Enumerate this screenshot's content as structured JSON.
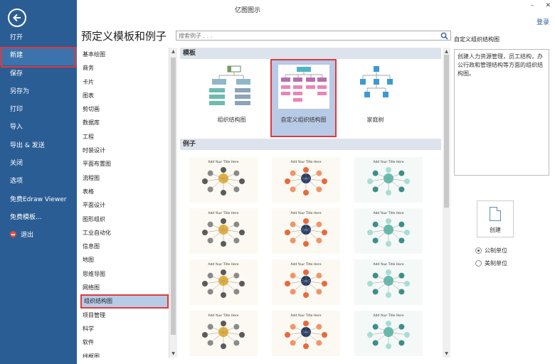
{
  "window": {
    "title": "亿图图示",
    "minimize": "–",
    "close": "✕",
    "login": "登录"
  },
  "rail": {
    "items": [
      {
        "label": "打开"
      },
      {
        "label": "新建",
        "selected": true
      },
      {
        "label": "保存"
      },
      {
        "label": "另存为"
      },
      {
        "label": "打印"
      },
      {
        "label": "导入"
      },
      {
        "label": "导出 & 发送"
      },
      {
        "label": "关闭"
      },
      {
        "label": "选项"
      },
      {
        "label": "免费Edraw Viewer"
      },
      {
        "label": "免费模板..."
      },
      {
        "label": "退出"
      }
    ]
  },
  "main": {
    "title": "预定义模板和例子",
    "search_placeholder": "搜索例子 . . ."
  },
  "categories": [
    "基本绘图",
    "商务",
    "卡片",
    "图表",
    "剪切画",
    "数据库",
    "工程",
    "时装设计",
    "平面布置图",
    "流程图",
    "表格",
    "平面设计",
    "图形组织",
    "工业自动化",
    "信息图",
    "地图",
    "思维导图",
    "网络图",
    "组织结构图",
    "项目管理",
    "科学",
    "软件",
    "线框图"
  ],
  "selected_category_index": 18,
  "gallery": {
    "templates_header": "模板",
    "examples_header": "例子",
    "templates": [
      {
        "label": "组织结构图"
      },
      {
        "label": "自定义组织结构图",
        "selected": true
      },
      {
        "label": "家庭树"
      }
    ],
    "example_title_text": "Add Your Title Here"
  },
  "preview": {
    "title": "自定义组织结构图",
    "description": "创建人力资源管理，员工结构，办公行政和管理结构等方面的组织结构图。",
    "create_label": "创建",
    "units": [
      {
        "label": "公制单位",
        "checked": true
      },
      {
        "label": "美制单位",
        "checked": false
      }
    ]
  },
  "colors": {
    "rail": "#2b5d95",
    "selection_outline": "#e03a3e",
    "selection_fill": "#b7cae6"
  }
}
